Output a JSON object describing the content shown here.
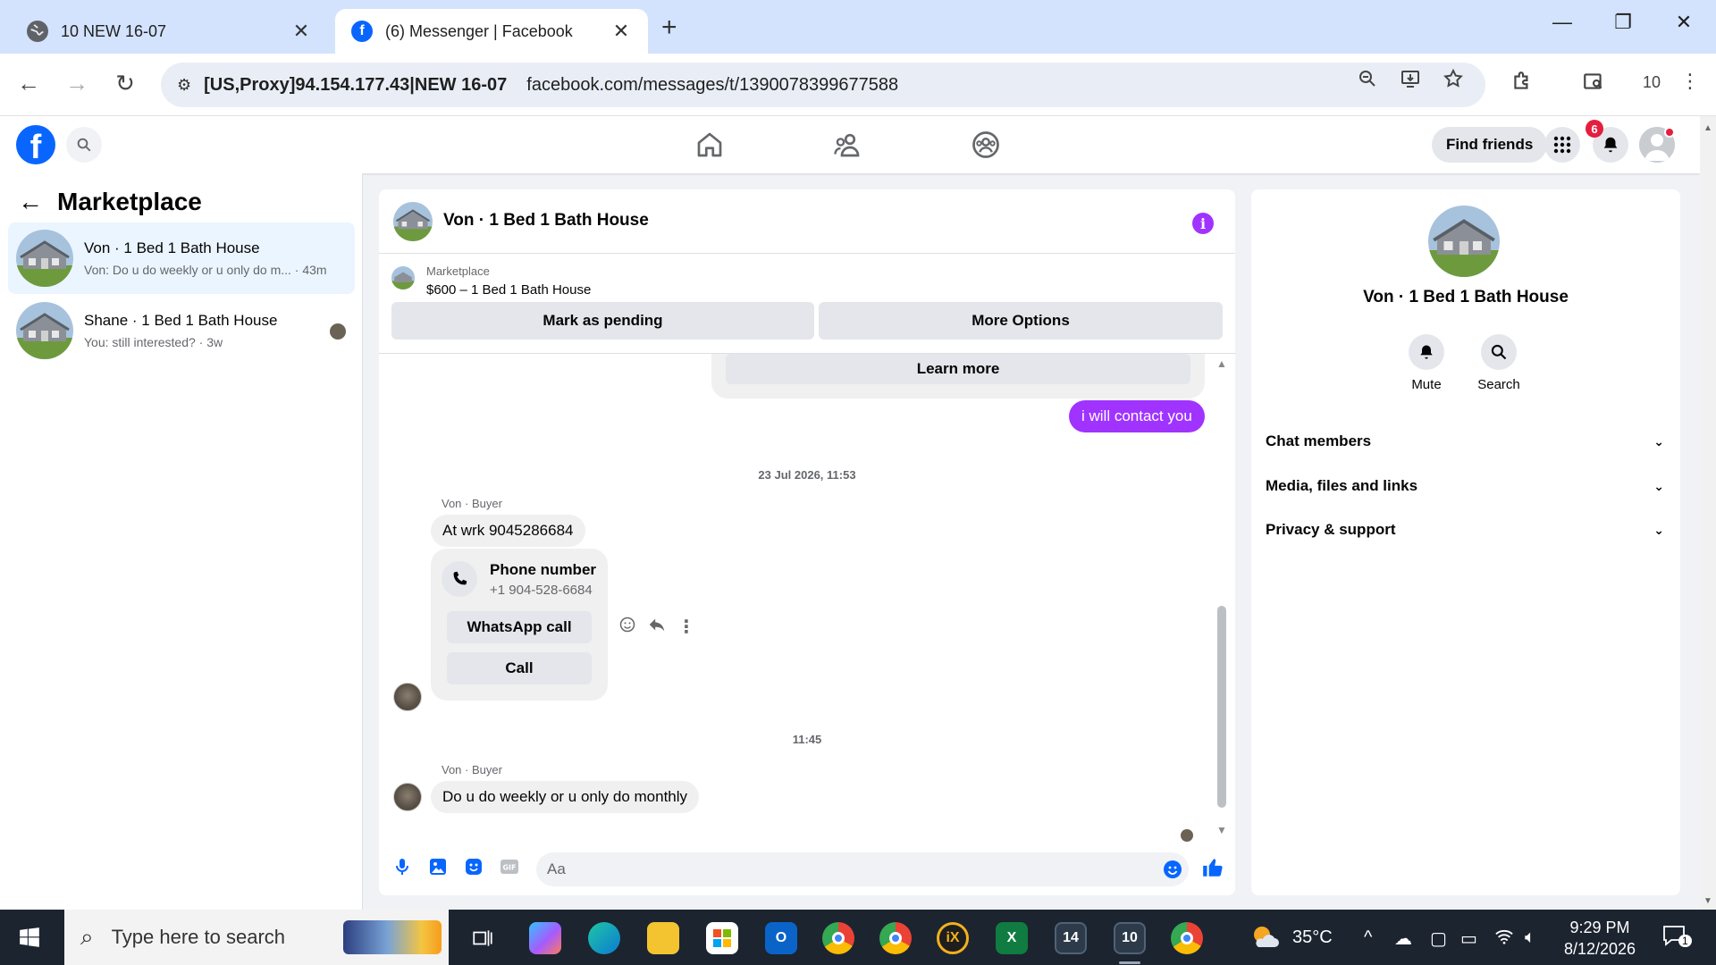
{
  "browser": {
    "tabs": [
      {
        "title": "10 NEW 16-07",
        "active": false
      },
      {
        "title": "(6) Messenger | Facebook",
        "active": true
      }
    ],
    "proxy_label": "[US,Proxy]94.154.177.43|NEW 16-07",
    "url": "facebook.com/messages/t/1390078399677588",
    "profile_count": "10"
  },
  "fb_header": {
    "find_friends": "Find friends",
    "notification_count": "6"
  },
  "sidebar": {
    "title": "Marketplace",
    "conversations": [
      {
        "name": "Von · 1 Bed 1 Bath House",
        "preview": "Von: Do u do weekly or u only do m... · 43m",
        "selected": true
      },
      {
        "name": "Shane · 1 Bed 1 Bath House",
        "preview": "You: still interested? · 3w",
        "selected": false
      }
    ]
  },
  "chat": {
    "title": "Von · 1 Bed 1 Bath House",
    "listing": {
      "category": "Marketplace",
      "title": "$600 – 1 Bed 1 Bath House",
      "mark_pending": "Mark as pending",
      "more_options": "More Options"
    },
    "learn_more": "Learn more",
    "outgoing_message": "i will contact you",
    "timestamp_1": "23 Jul 2026, 11:53",
    "sender_1": "Von · Buyer",
    "message_1": "At wrk 9045286684",
    "phone_card": {
      "title": "Phone number",
      "number": "+1 904-528-6684",
      "whatsapp": "WhatsApp call",
      "call": "Call"
    },
    "timestamp_2": "11:45",
    "sender_2": "Von · Buyer",
    "message_2": "Do u do weekly or u only do monthly",
    "input_placeholder": "Aa"
  },
  "info_panel": {
    "name": "Von · 1 Bed 1 Bath House",
    "actions": [
      "Mute",
      "Search"
    ],
    "sections": [
      "Chat members",
      "Media, files and links",
      "Privacy & support"
    ]
  },
  "taskbar": {
    "search_placeholder": "Type here to search",
    "weather": "35°C",
    "time": "9:29 PM",
    "date": "8/12/2026",
    "notification_count": "1",
    "app_badges": [
      "14",
      "10"
    ]
  },
  "colors": {
    "messenger_purple": "#a033ff",
    "facebook_blue": "#0866ff",
    "selected_bg": "#ebf5ff"
  }
}
